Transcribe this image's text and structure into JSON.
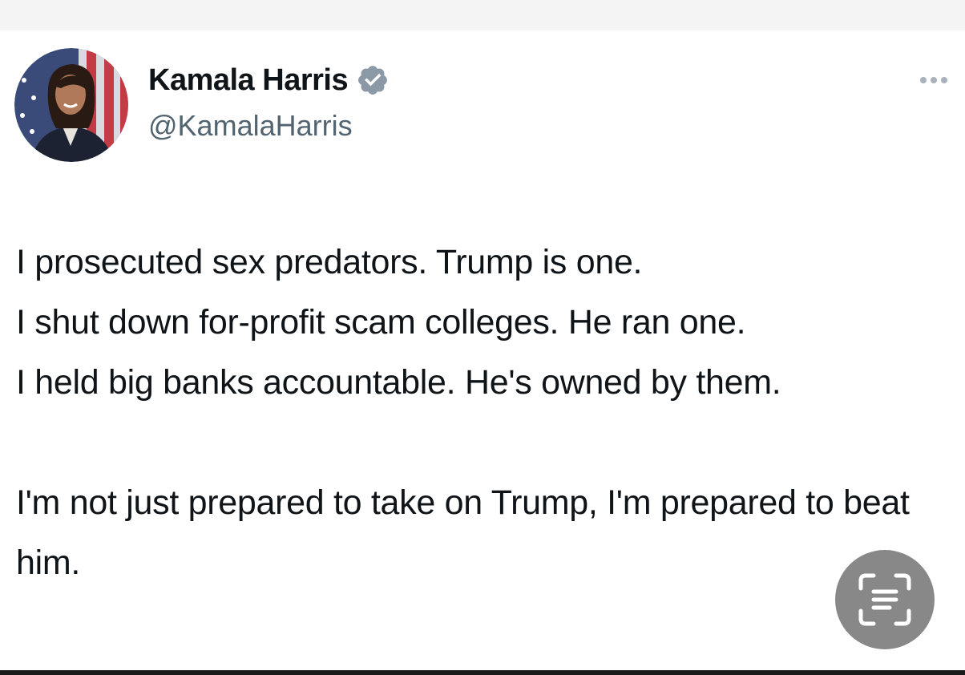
{
  "tweet": {
    "author": {
      "name": "Kamala Harris",
      "handle": "@KamalaHarris",
      "verified_icon": "verified-badge-icon",
      "verified_color": "#8b98a5"
    },
    "body_para1": "I prosecuted sex predators. Trump is one.\nI shut down for-profit scam colleges. He ran one.\nI held big banks accountable. He's owned by them.",
    "body_para2": "I'm not just prepared to take on Trump, I'm prepared to beat him.",
    "more_icon": "more-options-icon"
  },
  "overlay": {
    "scan_icon": "text-scan-icon",
    "scan_button_color": "#888888"
  },
  "colors": {
    "text_primary": "#0f1419",
    "text_secondary": "#536471"
  }
}
